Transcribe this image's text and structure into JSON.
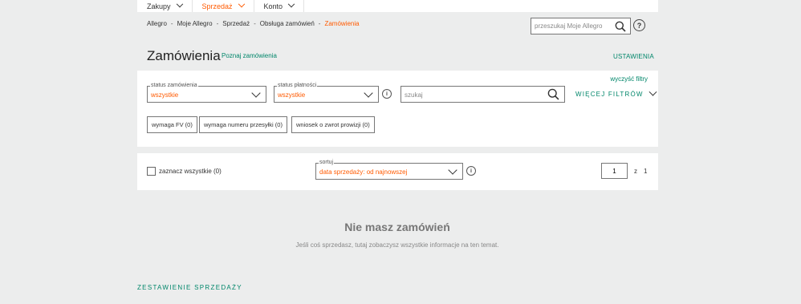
{
  "topnav": {
    "items": [
      {
        "label": "Zakupy",
        "icon": "chevron-down-icon"
      },
      {
        "label": "Sprzedaż",
        "icon": "chevron-down-icon",
        "active": true
      },
      {
        "label": "Konto",
        "icon": "chevron-down-icon"
      }
    ]
  },
  "breadcrumb": {
    "items": [
      "Allegro",
      "Moje Allegro",
      "Sprzedaż",
      "Obsługa zamówień",
      "Zamówienia"
    ],
    "separator": "-"
  },
  "search": {
    "placeholder": "przeszukaj Moje Allegro",
    "help_label": "?"
  },
  "header": {
    "title": "Zamówienia",
    "learn_link": "Poznaj zamówienia",
    "settings_link": "USTAWIENIA"
  },
  "filters": {
    "clear_link": "wyczyść filtry",
    "order_status": {
      "legend": "status zamówienia",
      "value": "wszystkie"
    },
    "payment_status": {
      "legend": "status płatności",
      "value": "wszystkie"
    },
    "search_placeholder": "szukaj",
    "more_filters": "WIĘCEJ FILTRÓW",
    "chips": [
      "wymaga FV (0)",
      "wymaga numeru przesyłki (0)",
      "wniosek o zwrot prowizji (0)"
    ]
  },
  "sortbar": {
    "select_all": "zaznacz wszystkie (0)",
    "sort_legend": "sortuj",
    "sort_value": "data sprzedaży: od najnowszej",
    "page_value": "1",
    "page_of": "z",
    "page_total": "1"
  },
  "empty": {
    "title": "Nie masz zamówień",
    "subtitle": "Jeśli coś sprzedasz, tutaj zobaczysz wszystkie informacje na ten temat."
  },
  "footer": {
    "summary_link": "ZESTAWIENIE SPRZEDAŻY"
  },
  "colors": {
    "accent": "#ff5a00",
    "link": "#00866a",
    "background": "#eceded"
  }
}
